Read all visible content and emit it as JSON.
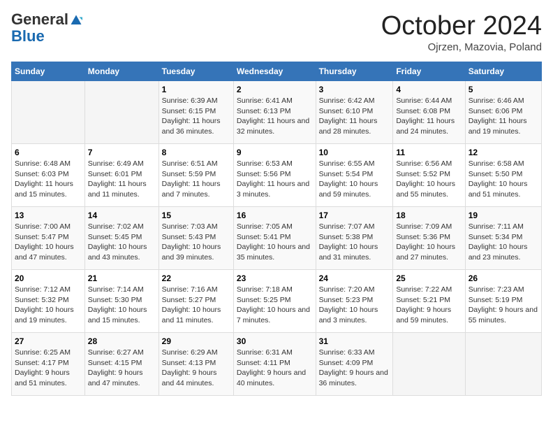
{
  "header": {
    "logo_general": "General",
    "logo_blue": "Blue",
    "month": "October 2024",
    "location": "Ojrzen, Mazovia, Poland"
  },
  "days_of_week": [
    "Sunday",
    "Monday",
    "Tuesday",
    "Wednesday",
    "Thursday",
    "Friday",
    "Saturday"
  ],
  "weeks": [
    [
      {
        "day": "",
        "info": ""
      },
      {
        "day": "",
        "info": ""
      },
      {
        "day": "1",
        "info": "Sunrise: 6:39 AM\nSunset: 6:15 PM\nDaylight: 11 hours and 36 minutes."
      },
      {
        "day": "2",
        "info": "Sunrise: 6:41 AM\nSunset: 6:13 PM\nDaylight: 11 hours and 32 minutes."
      },
      {
        "day": "3",
        "info": "Sunrise: 6:42 AM\nSunset: 6:10 PM\nDaylight: 11 hours and 28 minutes."
      },
      {
        "day": "4",
        "info": "Sunrise: 6:44 AM\nSunset: 6:08 PM\nDaylight: 11 hours and 24 minutes."
      },
      {
        "day": "5",
        "info": "Sunrise: 6:46 AM\nSunset: 6:06 PM\nDaylight: 11 hours and 19 minutes."
      }
    ],
    [
      {
        "day": "6",
        "info": "Sunrise: 6:48 AM\nSunset: 6:03 PM\nDaylight: 11 hours and 15 minutes."
      },
      {
        "day": "7",
        "info": "Sunrise: 6:49 AM\nSunset: 6:01 PM\nDaylight: 11 hours and 11 minutes."
      },
      {
        "day": "8",
        "info": "Sunrise: 6:51 AM\nSunset: 5:59 PM\nDaylight: 11 hours and 7 minutes."
      },
      {
        "day": "9",
        "info": "Sunrise: 6:53 AM\nSunset: 5:56 PM\nDaylight: 11 hours and 3 minutes."
      },
      {
        "day": "10",
        "info": "Sunrise: 6:55 AM\nSunset: 5:54 PM\nDaylight: 10 hours and 59 minutes."
      },
      {
        "day": "11",
        "info": "Sunrise: 6:56 AM\nSunset: 5:52 PM\nDaylight: 10 hours and 55 minutes."
      },
      {
        "day": "12",
        "info": "Sunrise: 6:58 AM\nSunset: 5:50 PM\nDaylight: 10 hours and 51 minutes."
      }
    ],
    [
      {
        "day": "13",
        "info": "Sunrise: 7:00 AM\nSunset: 5:47 PM\nDaylight: 10 hours and 47 minutes."
      },
      {
        "day": "14",
        "info": "Sunrise: 7:02 AM\nSunset: 5:45 PM\nDaylight: 10 hours and 43 minutes."
      },
      {
        "day": "15",
        "info": "Sunrise: 7:03 AM\nSunset: 5:43 PM\nDaylight: 10 hours and 39 minutes."
      },
      {
        "day": "16",
        "info": "Sunrise: 7:05 AM\nSunset: 5:41 PM\nDaylight: 10 hours and 35 minutes."
      },
      {
        "day": "17",
        "info": "Sunrise: 7:07 AM\nSunset: 5:38 PM\nDaylight: 10 hours and 31 minutes."
      },
      {
        "day": "18",
        "info": "Sunrise: 7:09 AM\nSunset: 5:36 PM\nDaylight: 10 hours and 27 minutes."
      },
      {
        "day": "19",
        "info": "Sunrise: 7:11 AM\nSunset: 5:34 PM\nDaylight: 10 hours and 23 minutes."
      }
    ],
    [
      {
        "day": "20",
        "info": "Sunrise: 7:12 AM\nSunset: 5:32 PM\nDaylight: 10 hours and 19 minutes."
      },
      {
        "day": "21",
        "info": "Sunrise: 7:14 AM\nSunset: 5:30 PM\nDaylight: 10 hours and 15 minutes."
      },
      {
        "day": "22",
        "info": "Sunrise: 7:16 AM\nSunset: 5:27 PM\nDaylight: 10 hours and 11 minutes."
      },
      {
        "day": "23",
        "info": "Sunrise: 7:18 AM\nSunset: 5:25 PM\nDaylight: 10 hours and 7 minutes."
      },
      {
        "day": "24",
        "info": "Sunrise: 7:20 AM\nSunset: 5:23 PM\nDaylight: 10 hours and 3 minutes."
      },
      {
        "day": "25",
        "info": "Sunrise: 7:22 AM\nSunset: 5:21 PM\nDaylight: 9 hours and 59 minutes."
      },
      {
        "day": "26",
        "info": "Sunrise: 7:23 AM\nSunset: 5:19 PM\nDaylight: 9 hours and 55 minutes."
      }
    ],
    [
      {
        "day": "27",
        "info": "Sunrise: 6:25 AM\nSunset: 4:17 PM\nDaylight: 9 hours and 51 minutes."
      },
      {
        "day": "28",
        "info": "Sunrise: 6:27 AM\nSunset: 4:15 PM\nDaylight: 9 hours and 47 minutes."
      },
      {
        "day": "29",
        "info": "Sunrise: 6:29 AM\nSunset: 4:13 PM\nDaylight: 9 hours and 44 minutes."
      },
      {
        "day": "30",
        "info": "Sunrise: 6:31 AM\nSunset: 4:11 PM\nDaylight: 9 hours and 40 minutes."
      },
      {
        "day": "31",
        "info": "Sunrise: 6:33 AM\nSunset: 4:09 PM\nDaylight: 9 hours and 36 minutes."
      },
      {
        "day": "",
        "info": ""
      },
      {
        "day": "",
        "info": ""
      }
    ]
  ]
}
